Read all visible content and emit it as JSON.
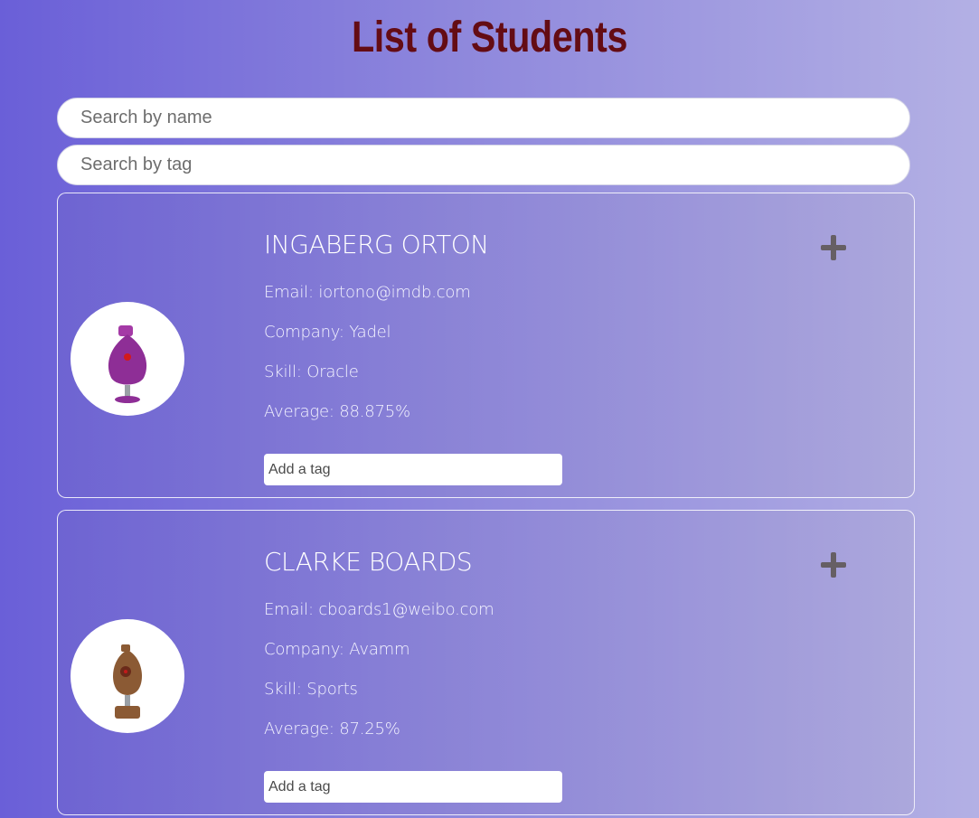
{
  "title": "List of Students",
  "search": {
    "name_placeholder": "Search by name",
    "tag_placeholder": "Search by tag"
  },
  "students": [
    {
      "name": "INGABERG ORTON",
      "email": "Email: iortono@imdb.com",
      "company": "Company: Yadel",
      "skill": "Skill: Oracle",
      "average": "Average: 88.875%",
      "tag_placeholder": "Add a tag",
      "avatar_color": "#8e2e96"
    },
    {
      "name": "CLARKE BOARDS",
      "email": "Email: cboards1@weibo.com",
      "company": "Company: Avamm",
      "skill": "Skill: Sports",
      "average": "Average: 87.25%",
      "tag_placeholder": "Add a tag",
      "avatar_color": "#8b5a34"
    }
  ],
  "icons": {
    "expand": "plus-icon",
    "avatar": "robot-avatar"
  },
  "colors": {
    "title": "#640c14",
    "plus": "#665f64"
  }
}
